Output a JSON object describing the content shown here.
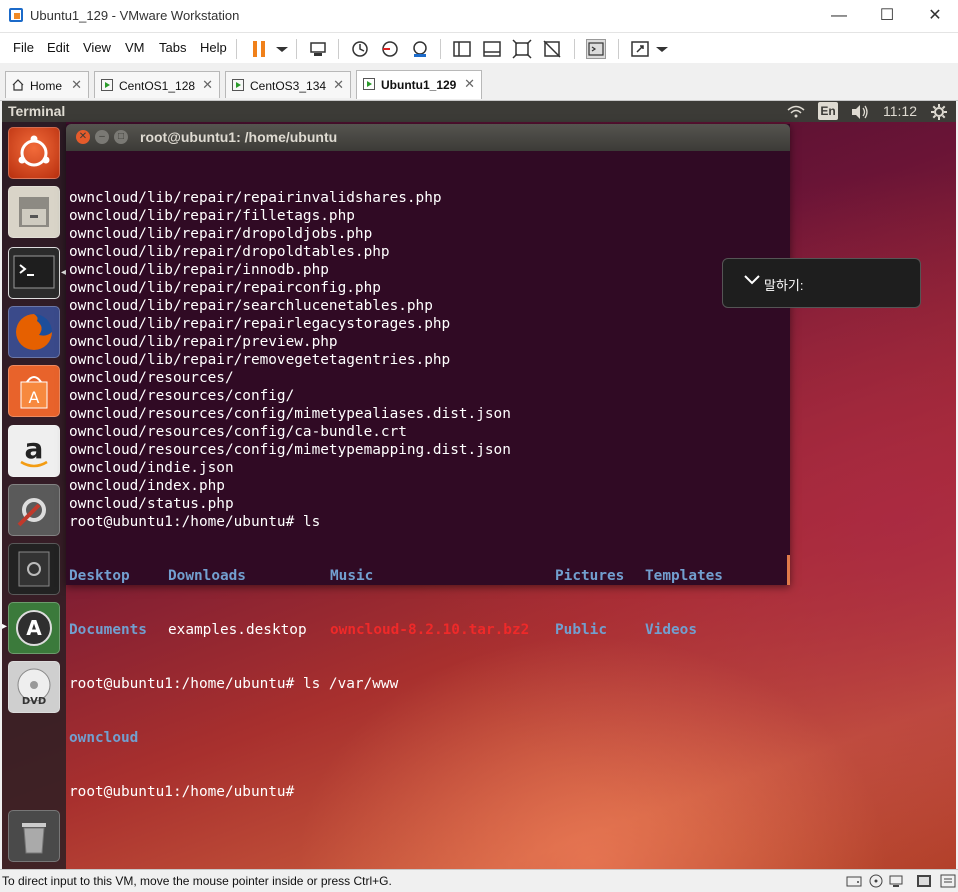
{
  "window": {
    "title": "Ubuntu1_129 - VMware Workstation",
    "minimize": "—",
    "maximize": "☐",
    "close": "✕"
  },
  "menu": [
    "File",
    "Edit",
    "View",
    "VM",
    "Tabs",
    "Help"
  ],
  "tabs": [
    {
      "label": "Home",
      "close": "✕"
    },
    {
      "label": "CentOS1_128",
      "close": "✕"
    },
    {
      "label": "CentOS3_134",
      "close": "✕"
    },
    {
      "label": "Ubuntu1_129",
      "close": "✕",
      "active": true
    }
  ],
  "ubuntu_panel": {
    "title": "Terminal",
    "keyboard": "En",
    "time": "11:12"
  },
  "terminal": {
    "title": "root@ubuntu1: /home/ubuntu",
    "lines": [
      "owncloud/lib/repair/repairinvalidshares.php",
      "owncloud/lib/repair/filletags.php",
      "owncloud/lib/repair/dropoldjobs.php",
      "owncloud/lib/repair/dropoldtables.php",
      "owncloud/lib/repair/innodb.php",
      "owncloud/lib/repair/repairconfig.php",
      "owncloud/lib/repair/searchlucenetables.php",
      "owncloud/lib/repair/repairlegacystorages.php",
      "owncloud/lib/repair/preview.php",
      "owncloud/lib/repair/removegetetagentries.php",
      "owncloud/resources/",
      "owncloud/resources/config/",
      "owncloud/resources/config/mimetypealiases.dist.json",
      "owncloud/resources/config/ca-bundle.crt",
      "owncloud/resources/config/mimetypemapping.dist.json",
      "owncloud/indie.json",
      "owncloud/index.php",
      "owncloud/status.php",
      "root@ubuntu1:/home/ubuntu# ls"
    ],
    "ls_row1": [
      "Desktop",
      "Downloads",
      "Music",
      "Pictures",
      "Templates"
    ],
    "ls_row2": [
      "Documents",
      "examples.desktop",
      "owncloud-8.2.10.tar.bz2",
      "Public",
      "Videos"
    ],
    "cmd2": "root@ubuntu1:/home/ubuntu# ls /var/www",
    "www_out": "owncloud",
    "prompt": "root@ubuntu1:/home/ubuntu#"
  },
  "speech_popup": {
    "label": "말하기:"
  },
  "status_bar": {
    "text": "To direct input to this VM, move the mouse pointer inside or press Ctrl+G."
  },
  "colors": {
    "terminal_bg": "#300a24",
    "dir": "#729fcf",
    "archive": "#ef2929",
    "panel": "#3c3b37"
  }
}
